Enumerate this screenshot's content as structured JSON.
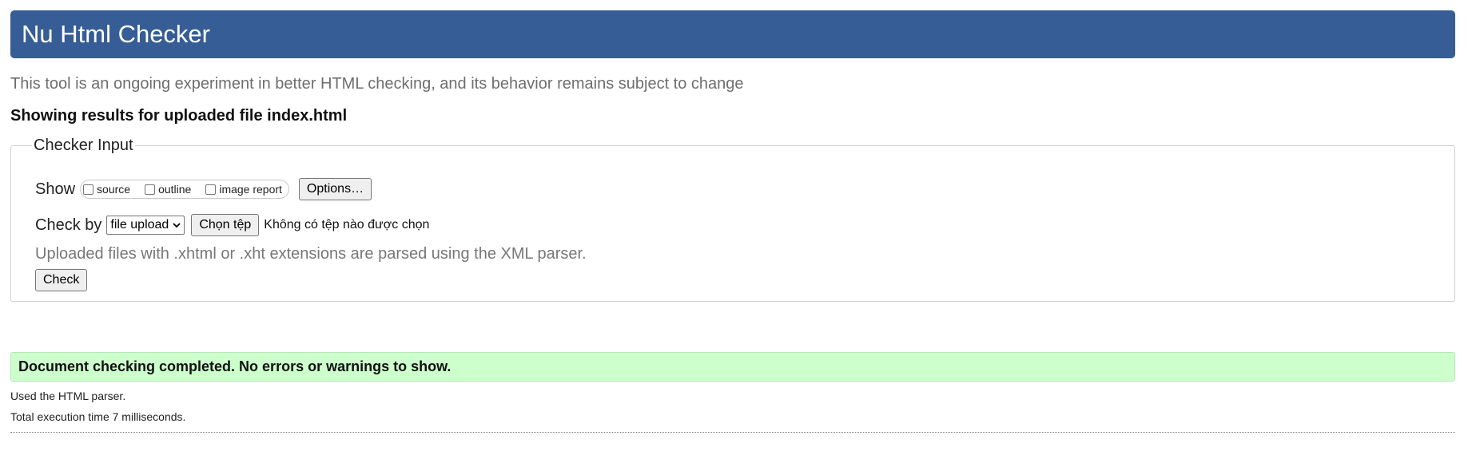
{
  "header": {
    "title": "Nu Html Checker"
  },
  "intro": "This tool is an ongoing experiment in better HTML checking, and its behavior remains subject to change",
  "showing_results": "Showing results for uploaded file index.html",
  "checker": {
    "legend": "Checker Input",
    "show_label": "Show",
    "show_options": [
      {
        "label": "source",
        "checked": false
      },
      {
        "label": "outline",
        "checked": false
      },
      {
        "label": "image report",
        "checked": false
      }
    ],
    "options_button": "Options…",
    "check_by_label": "Check by",
    "check_by_value": "file upload",
    "choose_file_button": "Chọn tệp",
    "no_file_text": "Không có tệp nào được chọn",
    "note": "Uploaded files with .xhtml or .xht extensions are parsed using the XML parser.",
    "check_button": "Check"
  },
  "result": {
    "message": "Document checking completed. No errors or warnings to show.",
    "parser": "Used the HTML parser.",
    "execution_time": "Total execution time 7 milliseconds."
  },
  "colors": {
    "header_bg": "#365d95",
    "success_bg": "#ccffcc"
  }
}
